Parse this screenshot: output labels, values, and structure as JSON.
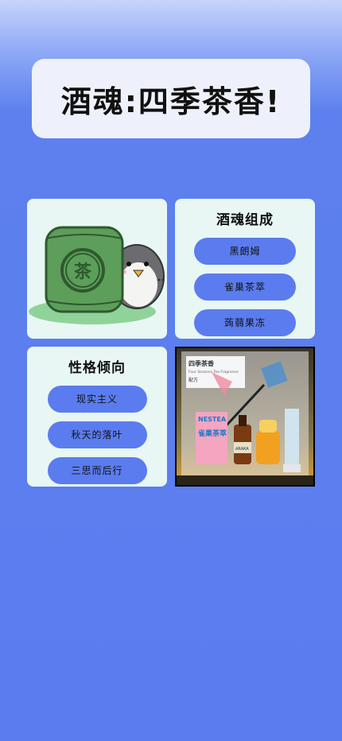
{
  "header": {
    "title": "酒魂:四季茶香!"
  },
  "illustration": {
    "label": "茶"
  },
  "composition": {
    "title": "酒魂组成",
    "items": [
      "黑朗姆",
      "雀巢茶萃",
      "蒟蒻果冻"
    ]
  },
  "personality": {
    "title": "性格倾向",
    "items": [
      "现实主义",
      "秋天的落叶",
      "三思而后行"
    ]
  },
  "photo": {
    "card_title": "四季茶香",
    "card_subtitle": "Four Seasons Tea Fragrance",
    "card_label": "配方",
    "bottle_brand": "NESTEA",
    "bottle_text": "雀巢茶萃",
    "bottle2_text": "ARAKA"
  },
  "colors": {
    "accent": "#5b7cef",
    "card_bg": "#e8f7f4",
    "title_bg": "#eef1fb"
  }
}
